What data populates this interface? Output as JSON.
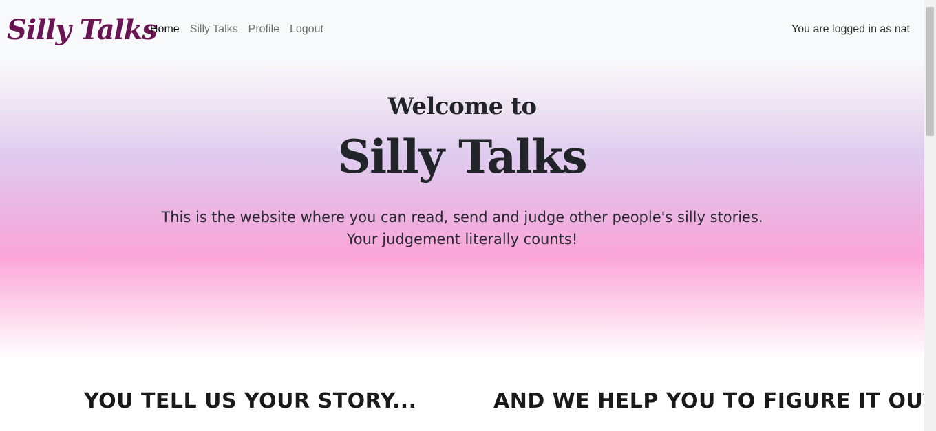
{
  "navbar": {
    "brand": "Silly Talks",
    "links": [
      {
        "label": "Home"
      },
      {
        "label": "Silly Talks"
      },
      {
        "label": "Profile"
      },
      {
        "label": "Logout"
      }
    ],
    "status": "You are logged in as nat"
  },
  "hero": {
    "subtitle": "Welcome to",
    "title": "Silly Talks",
    "line1": "This is the website where you can read, send and judge other people's silly stories.",
    "line2": "Your judgement literally counts!"
  },
  "sections": {
    "left_title": "YOU TELL US YOUR STORY...",
    "right_title": "AND WE HELP YOU TO FIGURE IT OUT!"
  },
  "colors": {
    "brand": "#6b1454",
    "gradient_pink": "#fba6d8",
    "gradient_lavender": "#dfcbef"
  }
}
